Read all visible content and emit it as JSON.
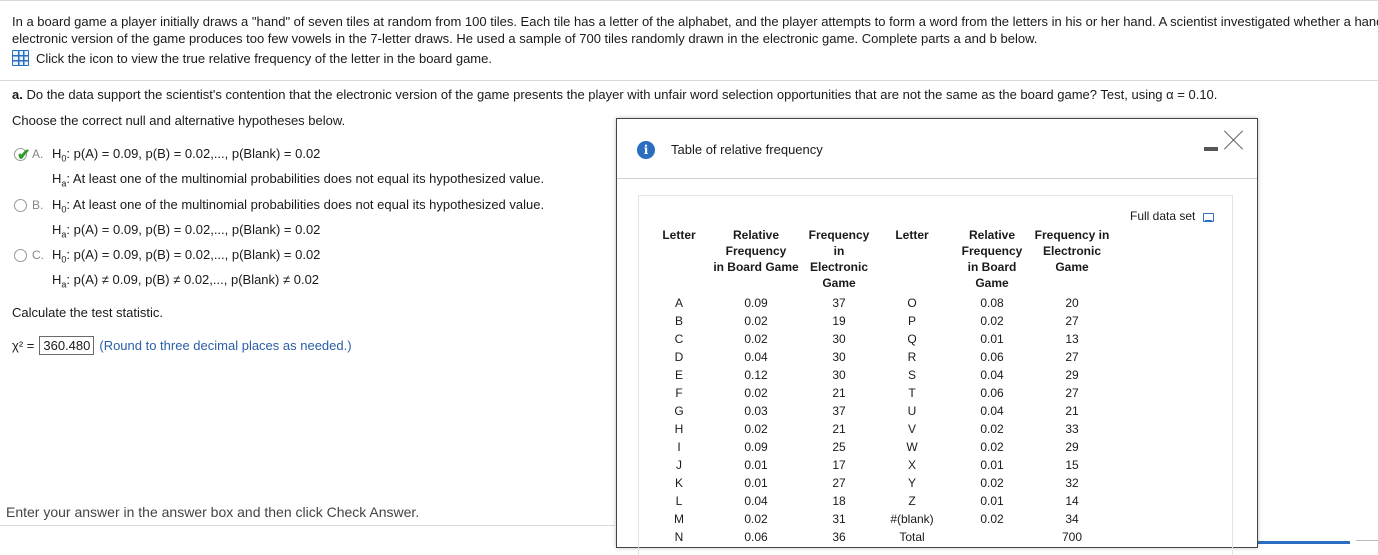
{
  "intro": {
    "line1": "In a board game a player initially draws a \"hand\" of seven tiles at random from 100 tiles. Each tile has a letter of the alphabet, and the player attempts to form a word from the letters in his or her hand. A scientist investigated whether a hand",
    "line2": "electronic version of the game produces too few vowels in the 7-letter draws. He used a sample of 700 tiles randomly drawn in the electronic game. Complete parts a and b below."
  },
  "data_link": {
    "label": "Click the icon to view the true relative frequency of the letter in the board game.",
    "icon": "table-grid-icon"
  },
  "question": {
    "part": "a.",
    "text": "Do the data support the scientist's contention that the electronic version of the game presents the player with unfair word selection opportunities that are not the same as the board game? Test, using α = 0.10."
  },
  "choose_label": "Choose the correct null and alternative hypotheses below.",
  "options": [
    {
      "letter": "A.",
      "h0": ": p(A) = 0.09, p(B) = 0.02,..., p(Blank) = 0.02",
      "ha": ": At least one of the multinomial probabilities does not equal its hypothesized value.",
      "selected": true
    },
    {
      "letter": "B.",
      "h0": ": At least one of the multinomial probabilities does not equal its hypothesized value.",
      "ha": ": p(A) = 0.09, p(B) = 0.02,..., p(Blank) = 0.02",
      "selected": false
    },
    {
      "letter": "C.",
      "h0": ": p(A) = 0.09, p(B) = 0.02,..., p(Blank) = 0.02",
      "ha": ": p(A) ≠ 0.09, p(B) ≠ 0.02,..., p(Blank) ≠ 0.02",
      "selected": false
    }
  ],
  "calc_label": "Calculate the test statistic.",
  "chi_label": "χ² =",
  "chi_value": "360.480",
  "chi_hint": "(Round to three decimal places as needed.)",
  "enter_hint": "Enter your answer in the answer box and then click Check Answer.",
  "dialog": {
    "title": "Table of relative frequency",
    "full_data_label": "Full data set",
    "headers": [
      [
        "Letter"
      ],
      [
        "Relative",
        "Frequency",
        "in Board Game"
      ],
      [
        "Frequency",
        "in",
        "Electronic",
        "Game"
      ],
      [
        "Letter"
      ],
      [
        "Relative",
        "Frequency",
        "in Board",
        "Game"
      ],
      [
        "Frequency in",
        "Electronic",
        "Game"
      ]
    ],
    "rows": [
      [
        "A",
        "0.09",
        "37",
        "O",
        "0.08",
        "20"
      ],
      [
        "B",
        "0.02",
        "19",
        "P",
        "0.02",
        "27"
      ],
      [
        "C",
        "0.02",
        "30",
        "Q",
        "0.01",
        "13"
      ],
      [
        "D",
        "0.04",
        "30",
        "R",
        "0.06",
        "27"
      ],
      [
        "E",
        "0.12",
        "30",
        "S",
        "0.04",
        "29"
      ],
      [
        "F",
        "0.02",
        "21",
        "T",
        "0.06",
        "27"
      ],
      [
        "G",
        "0.03",
        "37",
        "U",
        "0.04",
        "21"
      ],
      [
        "H",
        "0.02",
        "21",
        "V",
        "0.02",
        "33"
      ],
      [
        "I",
        "0.09",
        "25",
        "W",
        "0.02",
        "29"
      ],
      [
        "J",
        "0.01",
        "17",
        "X",
        "0.01",
        "15"
      ],
      [
        "K",
        "0.01",
        "27",
        "Y",
        "0.02",
        "32"
      ],
      [
        "L",
        "0.04",
        "18",
        "Z",
        "0.01",
        "14"
      ],
      [
        "M",
        "0.02",
        "31",
        "#(blank)",
        "0.02",
        "34"
      ],
      [
        "N",
        "0.06",
        "36",
        "Total",
        "",
        "700"
      ]
    ]
  }
}
